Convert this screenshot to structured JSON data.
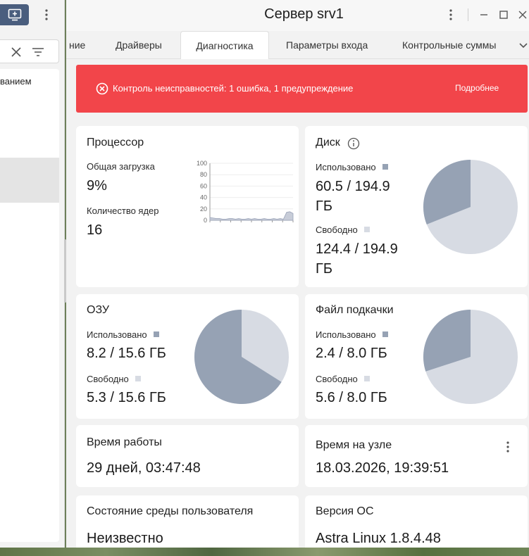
{
  "left": {
    "tree_item": "ванием"
  },
  "window": {
    "title": "Сервер srv1"
  },
  "tabs": [
    {
      "label": "ние"
    },
    {
      "label": "Драйверы"
    },
    {
      "label": "Диагностика"
    },
    {
      "label": "Параметры входа"
    },
    {
      "label": "Контрольные суммы"
    }
  ],
  "alert": {
    "text": "Контроль неисправностей: 1 ошибка, 1 предупреждение",
    "more": "Подробнее",
    "color": "#f2454a"
  },
  "cpu": {
    "title": "Процессор",
    "load_label": "Общая загрузка",
    "load_value": "9%",
    "cores_label": "Количество ядер",
    "cores_value": "16",
    "chart_data": {
      "type": "area",
      "ylim": [
        0,
        100
      ],
      "yticks": [
        "100",
        "80",
        "60",
        "40",
        "20",
        "0"
      ],
      "values": [
        5,
        4,
        3,
        3,
        2,
        2,
        3,
        3,
        2,
        3,
        2,
        2,
        3,
        2,
        3,
        2,
        2,
        3,
        2,
        2,
        3,
        2,
        3,
        2,
        14,
        15,
        12
      ]
    }
  },
  "disk": {
    "title": "Диск",
    "used_label": "Использовано",
    "used_value": "60.5 / 194.9 ГБ",
    "free_label": "Свободно",
    "free_value": "124.4 / 194.9 ГБ",
    "used_fraction": 0.3104
  },
  "ram": {
    "title": "ОЗУ",
    "used_label": "Использовано",
    "used_value": "8.2 / 15.6 ГБ",
    "free_label": "Свободно",
    "free_value": "5.3 / 15.6 ГБ",
    "used_fraction": 0.6603
  },
  "swap": {
    "title": "Файл подкачки",
    "used_label": "Использовано",
    "used_value": "2.4 / 8.0 ГБ",
    "free_label": "Свободно",
    "free_value": "5.6 / 8.0 ГБ",
    "used_fraction": 0.3
  },
  "uptime": {
    "title": "Время работы",
    "value": "29 дней, 03:47:48"
  },
  "node_time": {
    "title": "Время на узле",
    "value": "18.03.2026, 19:39:51"
  },
  "user_env": {
    "title": "Состояние среды пользователя",
    "value": "Неизвестно"
  },
  "os_version": {
    "title": "Версия ОС",
    "value": "Astra Linux 1.8.4.48"
  },
  "colors": {
    "used": "#96a2b4",
    "free": "#d7dbe3",
    "accent": "#4a5e7e"
  }
}
